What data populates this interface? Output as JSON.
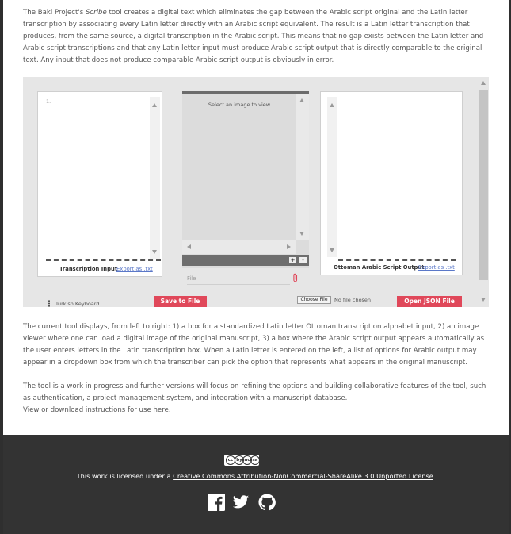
{
  "intro": {
    "prefix": "The Baki Project's ",
    "tool_name": "Scribe",
    "text": " tool creates a digital text which eliminates the gap between the Arabic script original and the Latin letter transcription by associating every Latin letter directly with an Arabic script equivalent.  The result is a Latin letter transcription that produces, from the same source, a digital transcription in the Arabic script.  This means that no gap exists between the Latin letter and Arabic script transcriptions and that any Latin letter input must produce Arabic script output that is directly comparable to the original text.  Any input that does not produce comparable Arabic script output is obviously in error."
  },
  "tool": {
    "transcription": {
      "line_number": "1.",
      "caption": "Transcription Input",
      "export_label": "Export as .txt"
    },
    "viewer": {
      "placeholder": "Select an image to view",
      "zoom_in": "+",
      "zoom_out": "-",
      "file_placeholder": "File"
    },
    "output": {
      "caption": "Ottoman Arabic Script Output",
      "export_label": "Export as .txt"
    },
    "keyboard_label": "Turkish Keyboard",
    "save_label": "Save to File",
    "choose_file_label": "Choose File",
    "no_file_text": "No file chosen",
    "open_json_label": "Open JSON File"
  },
  "description": {
    "p2": "The current tool displays, from left to right: 1) a box for a standardized Latin letter Ottoman transcription alphabet input, 2) an image viewer where one can load a digital image of the original manuscript, 3) a box where the Arabic script output appears automatically as the user enters letters in the Latin transcription box.  When a Latin letter is entered on the left, a list of options for Arabic output may appear in a dropdown box from which the transcriber can pick the option that represents what appears in the original manuscript.",
    "p3": "The tool is a work in progress and further versions will focus on refining the options and building collaborative features of the tool, such as authentication, a project management system, and integration with a manuscript database.",
    "instructions_link": "View or download instructions for use here."
  },
  "footer": {
    "license_prefix": "This work is licensed under a ",
    "license_link": "Creative Commons Attribution-NonCommercial-ShareAlike 3.0 Unported License",
    "license_suffix": ".",
    "cc_badge": [
      "cc",
      "by",
      "nc",
      "sa"
    ],
    "icons": [
      "facebook-icon",
      "twitter-icon",
      "github-icon"
    ],
    "bg_color": "#333333"
  },
  "colors": {
    "accent": "#e0485a",
    "link": "#5b78c8"
  }
}
